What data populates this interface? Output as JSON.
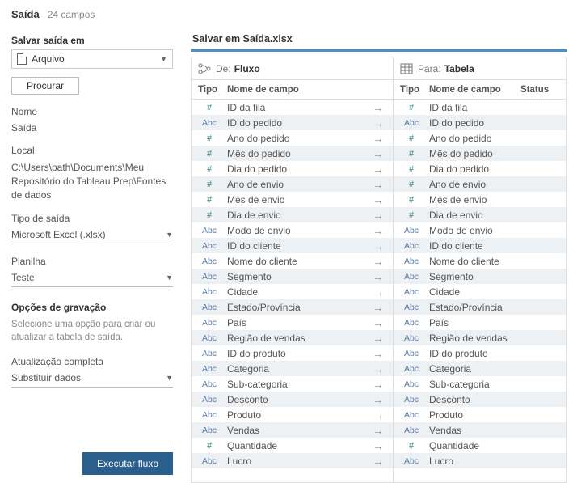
{
  "header": {
    "title": "Saída",
    "fields_count": "24 campos"
  },
  "sidebar": {
    "save_in_label": "Salvar saída em",
    "save_in_value": "Arquivo",
    "browse": "Procurar",
    "name_label": "Nome",
    "name_value": "Saída",
    "location_label": "Local",
    "location_value": "C:\\Users\\path\\Documents\\Meu Repositório do Tableau Prep\\Fontes de dados",
    "output_type_label": "Tipo de saída",
    "output_type_value": "Microsoft Excel (.xlsx)",
    "sheet_label": "Planilha",
    "sheet_value": "Teste",
    "write_options_title": "Opções de gravação",
    "write_options_desc": "Selecione uma opção para criar ou atualizar a tabela de saída.",
    "full_refresh_label": "Atualização completa",
    "full_refresh_value": "Substituir dados",
    "run_flow": "Executar fluxo"
  },
  "content": {
    "title": "Salvar em Saída.xlsx",
    "from_label": "De:",
    "from_value": "Fluxo",
    "to_label": "Para:",
    "to_value": "Tabela",
    "col_type": "Tipo",
    "col_name": "Nome de campo",
    "col_status": "Status"
  },
  "fields": [
    {
      "type": "#",
      "name": "ID da fila"
    },
    {
      "type": "Abc",
      "name": "ID do pedido"
    },
    {
      "type": "#",
      "name": "Ano do pedido"
    },
    {
      "type": "#",
      "name": "Mês do pedido"
    },
    {
      "type": "#",
      "name": "Dia do pedido"
    },
    {
      "type": "#",
      "name": "Ano de envio"
    },
    {
      "type": "#",
      "name": "Mês de envio"
    },
    {
      "type": "#",
      "name": "Dia de envio"
    },
    {
      "type": "Abc",
      "name": "Modo de envio"
    },
    {
      "type": "Abc",
      "name": "ID do cliente"
    },
    {
      "type": "Abc",
      "name": "Nome do cliente"
    },
    {
      "type": "Abc",
      "name": "Segmento"
    },
    {
      "type": "Abc",
      "name": "Cidade"
    },
    {
      "type": "Abc",
      "name": "Estado/Província"
    },
    {
      "type": "Abc",
      "name": "País"
    },
    {
      "type": "Abc",
      "name": "Região de vendas"
    },
    {
      "type": "Abc",
      "name": "ID do produto"
    },
    {
      "type": "Abc",
      "name": "Categoria"
    },
    {
      "type": "Abc",
      "name": "Sub-categoria"
    },
    {
      "type": "Abc",
      "name": "Desconto"
    },
    {
      "type": "Abc",
      "name": "Produto"
    },
    {
      "type": "Abc",
      "name": "Vendas"
    },
    {
      "type": "#",
      "name": "Quantidade"
    },
    {
      "type": "Abc",
      "name": "Lucro"
    }
  ]
}
